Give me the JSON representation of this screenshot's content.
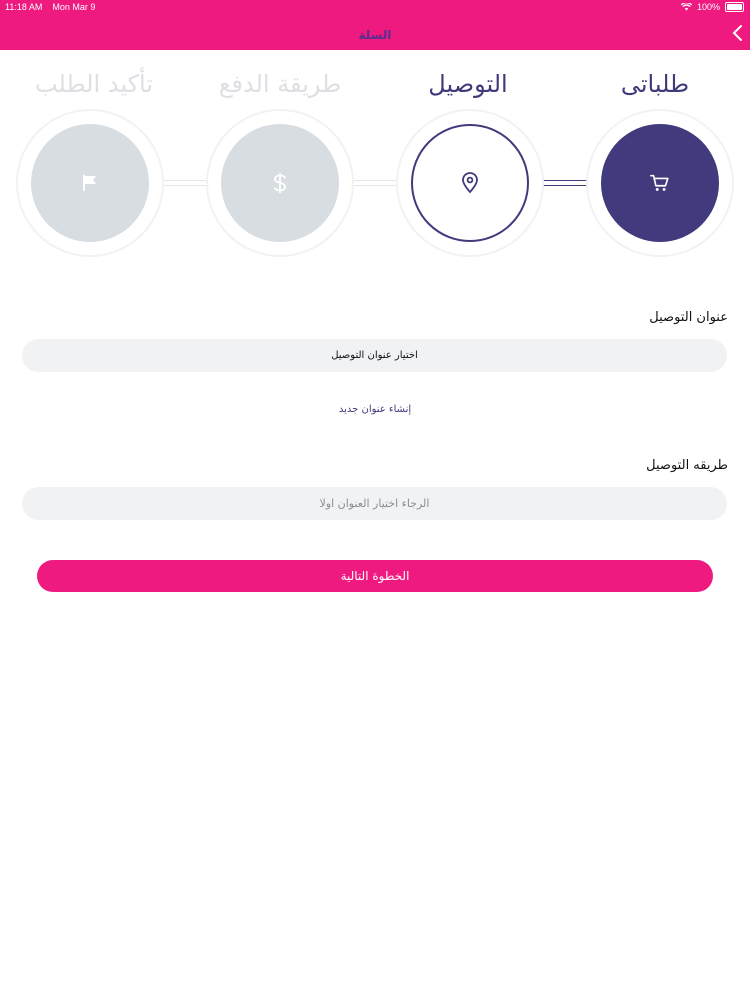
{
  "status_bar": {
    "time": "11:18 AM",
    "date": "Mon Mar 9",
    "battery": "100%"
  },
  "nav": {
    "title": "السلة"
  },
  "steps": [
    {
      "label": "طلباتى",
      "state": "done",
      "icon": "cart-icon"
    },
    {
      "label": "التوصيل",
      "state": "current",
      "icon": "location-pin-icon"
    },
    {
      "label": "طريقة الدفع",
      "state": "todo",
      "icon": "dollar-icon"
    },
    {
      "label": "تأكيد الطلب",
      "state": "todo",
      "icon": "flag-icon"
    }
  ],
  "delivery_address": {
    "title": "عنوان التوصيل",
    "select_value": "اختيار عنوان التوصيل",
    "create_link": "إنشاء عنوان جديد"
  },
  "delivery_method": {
    "title": "طريقه التوصيل",
    "placeholder": "الرجاء اختيار العنوان اولا"
  },
  "next_button": "الخطوة التالية",
  "colors": {
    "brand_pink": "#ee1a80",
    "brand_purple": "#413a7c",
    "inactive": "#d8dde2"
  }
}
